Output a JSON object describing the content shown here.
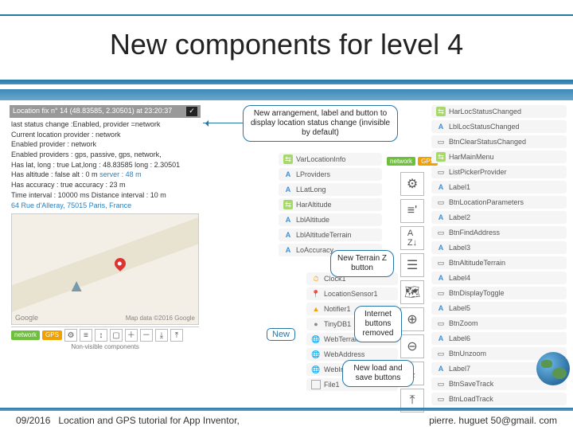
{
  "title": "New components for level 4",
  "phone": {
    "head": "Location fix n° 14 (48.83585, 2.30501) at 23:20:37",
    "lines": [
      "last status change :Enabled, provider =network",
      "Current location provider : network",
      "Enabled provider           : network",
      "Enabled providers : gps, passive, gps, network,",
      "Has lat, long : true Lat,long : 48.83585 long : 2.30501"
    ],
    "altitude_pre": "Has altitude : false alt : 0 m ",
    "altitude_srv": "server : 48 m",
    "accuracy": "Has accuracy : true accuracy : 23 m",
    "interval": "Time interval : 10000 ms  Distance interval : 10 m",
    "address": "64 Rue d'Alleray, 75015 Paris, France",
    "google": "Google",
    "credits": "Map data ©2016 Google",
    "chip_network": "network",
    "chip_gps": "GPS",
    "nonvis": "Non-visible components"
  },
  "bubble_top": "New arrangement, label and button\nto display location status change\n(invisible by default)",
  "bubble_terrain": "New Terrain Z\nbutton",
  "bubble_internet": "Internet\nbuttons\nremoved",
  "bubble_save": "New load and\nsave buttons",
  "new_label": "New",
  "center_comps_top": [
    {
      "icon": "igreen",
      "glyph": "⇆",
      "label": "VarLocationInfo"
    },
    {
      "icon": "iblue",
      "glyph": "A",
      "label": "LProviders"
    },
    {
      "icon": "iblue",
      "glyph": "A",
      "label": "LLatLong"
    },
    {
      "icon": "igreen",
      "glyph": "⇆",
      "label": "HarAltitude"
    },
    {
      "icon": "iblue",
      "glyph": "A",
      "label": "LblAltitude"
    },
    {
      "icon": "iblue",
      "glyph": "A",
      "label": "LblAltitudeTerrain"
    },
    {
      "icon": "iblue",
      "glyph": "A",
      "label": "LoAccuracy"
    }
  ],
  "center_comps_bottom": [
    {
      "icon": "iorange",
      "glyph": "⏱",
      "label": "Clock1"
    },
    {
      "icon": "ired",
      "glyph": "📍",
      "label": "LocationSensor1"
    },
    {
      "icon": "iorange",
      "glyph": "▲",
      "label": "Notifier1"
    },
    {
      "icon": "igrey",
      "glyph": "●",
      "label": "TinyDB1"
    },
    {
      "icon": "ipurple",
      "glyph": "🌐",
      "label": "WebTerrainZ"
    },
    {
      "icon": "ipurple",
      "glyph": "🌐",
      "label": "WebAddress"
    },
    {
      "icon": "ipurple",
      "glyph": "🌐",
      "label": "WebImage"
    },
    {
      "icon": "ipaper",
      "glyph": "",
      "label": "File1"
    }
  ],
  "right_chips": {
    "network": "network",
    "gps": "GPS"
  },
  "right_comps": [
    {
      "icon": "igreen",
      "glyph": "⇆",
      "label": "HarLocStatusChanged"
    },
    {
      "icon": "iblue",
      "glyph": "A",
      "label": "LblLocStatusChanged"
    },
    {
      "icon": "",
      "glyph": "▭",
      "label": "BtnClearStatusChanged"
    },
    {
      "icon": "igreen",
      "glyph": "⇆",
      "label": "HarMainMenu"
    },
    {
      "icon": "",
      "glyph": "▭",
      "label": "ListPickerProvider"
    },
    {
      "icon": "iblue",
      "glyph": "A",
      "label": "Label1"
    },
    {
      "icon": "",
      "glyph": "▭",
      "label": "BtnLocationParameters"
    },
    {
      "icon": "iblue",
      "glyph": "A",
      "label": "Label2"
    },
    {
      "icon": "",
      "glyph": "▭",
      "label": "BtnFindAddress"
    },
    {
      "icon": "iblue",
      "glyph": "A",
      "label": "Label3"
    },
    {
      "icon": "",
      "glyph": "▭",
      "label": "BtnAltitudeTerrain"
    },
    {
      "icon": "iblue",
      "glyph": "A",
      "label": "Label4"
    },
    {
      "icon": "",
      "glyph": "▭",
      "label": "BtnDisplayToggle"
    },
    {
      "icon": "iblue",
      "glyph": "A",
      "label": "Label5"
    },
    {
      "icon": "",
      "glyph": "▭",
      "label": "BtnZoom"
    },
    {
      "icon": "iblue",
      "glyph": "A",
      "label": "Label6"
    },
    {
      "icon": "",
      "glyph": "▭",
      "label": "BtnUnzoom"
    },
    {
      "icon": "iblue",
      "glyph": "A",
      "label": "Label7"
    },
    {
      "icon": "",
      "glyph": "▭",
      "label": "BtnSaveTrack"
    },
    {
      "icon": "",
      "glyph": "▭",
      "label": "BtnLoadTrack"
    }
  ],
  "footer": {
    "date": "09/2016",
    "text": "Location and GPS tutorial for App Inventor,",
    "email": "pierre. huguet 50@gmail. com"
  }
}
